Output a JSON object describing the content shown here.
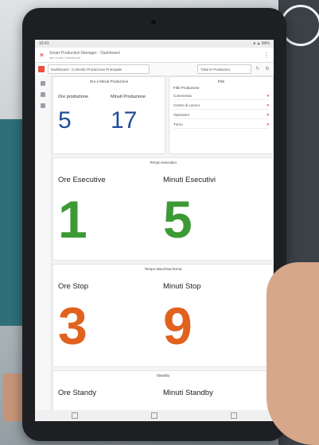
{
  "browser": {
    "title": "Smart Production Manager - Dashboard",
    "subtitle": "spm.local / dashboard",
    "status_left": "10:41",
    "status_right": "● ▲ 84%"
  },
  "toolbar": {
    "select_value": "Dashboard - Controllo Produzione Principale",
    "select2_value": "Tutte le Postazioni"
  },
  "kpi_panel": {
    "title": "Ore e Minuti Produzione",
    "ore_label": "Ore produzione",
    "ore_value": "5",
    "minuti_label": "Minuti Produzione",
    "minuti_value": "17"
  },
  "filter_panel": {
    "title": "Filtri",
    "section": "Filtri Produzione",
    "rows": [
      "Commessa",
      "Centro di Lavoro",
      "Operatore",
      "Turno"
    ]
  },
  "esecutivo": {
    "section_title": "Tempo esecutivo",
    "ore_label": "Ore Esecutive",
    "ore_value": "1",
    "minuti_label": "Minuti Esecutivi",
    "minuti_value": "5"
  },
  "stop": {
    "section_title": "Tempo Macchina ferma",
    "ore_label": "Ore Stop",
    "ore_value": "3",
    "minuti_label": "Minuti Stop",
    "minuti_value": "9"
  },
  "standby": {
    "section_title": "Standby",
    "ore_label": "Ore Standy",
    "minuti_label": "Minuti Standby"
  },
  "colors": {
    "blue_kpi": "#1f4e9c",
    "green_kpi": "#3c9a35",
    "orange_kpi": "#e0621e"
  }
}
